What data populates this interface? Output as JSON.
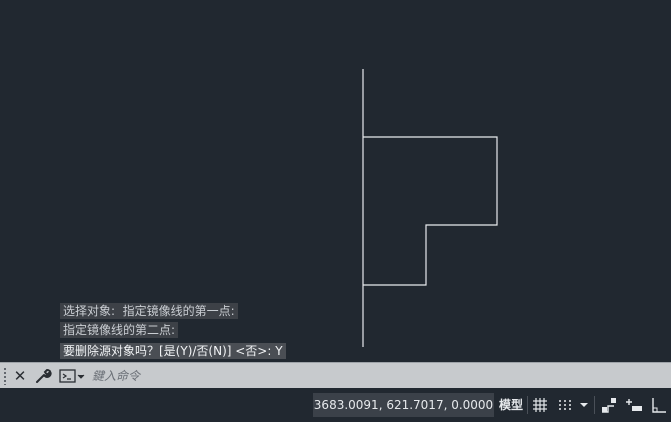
{
  "command_history": [
    "选择对象:  指定镜像线的第一点:",
    "指定镜像线的第二点:",
    "要删除源对象吗？[是(Y)/否(N)] <否>: Y"
  ],
  "command_line": {
    "placeholder": "鍵入命令"
  },
  "status_bar": {
    "coordinates": "3683.0091, 621.7017, 0.0000",
    "model_label": "模型"
  },
  "icons": {
    "grip": "grip-icon",
    "close": "close-icon",
    "customize": "wrench-icon",
    "recent_commands": "terminal-icon",
    "grid": "grid-icon",
    "snap": "snap-dots-icon",
    "snap_menu": "chevron-down-icon",
    "infer_constraints": "infer-constraints-icon",
    "dynamic_input": "dynamic-input-icon",
    "ortho": "ortho-icon"
  },
  "colors": {
    "canvas_bg": "#212830",
    "geometry": "#e8eaed",
    "command_bar_bg": "#c7cacd"
  }
}
